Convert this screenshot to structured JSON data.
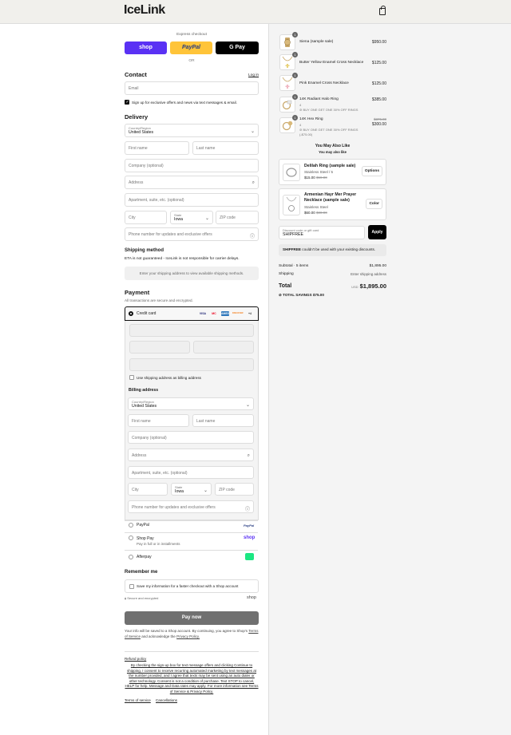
{
  "brand": {
    "logo": "IceLink"
  },
  "express": {
    "title": "Express checkout",
    "shop": "shop",
    "paypal": "PayPal",
    "gpay": "G Pay",
    "or": "OR"
  },
  "contact": {
    "heading": "Contact",
    "login": "Log in",
    "email_placeholder": "Email",
    "signup_text": "Sign up for exclusive offers and news via text messages & email."
  },
  "delivery": {
    "heading": "Delivery",
    "country_label": "Country/Region",
    "country_value": "United States",
    "first_name": "First name",
    "last_name": "Last name",
    "company": "Company (optional)",
    "address": "Address",
    "apartment": "Apartment, suite, etc. (optional)",
    "city": "City",
    "state_label": "State",
    "state_value": "Iowa",
    "zip": "ZIP code",
    "phone": "Phone number for updates and exclusive offers"
  },
  "shipping": {
    "heading": "Shipping method",
    "eta_note": "ETA is not guaranteed - IceLink is not responsible for carrier delays.",
    "placeholder": "Enter your shipping address to view available shipping methods."
  },
  "payment": {
    "heading": "Payment",
    "subtext": "All transactions are secure and encrypted.",
    "credit_card": "Credit card",
    "cards": [
      "VISA",
      "MC",
      "AMEX",
      "DISCOVER",
      "+4"
    ],
    "use_shipping": "Use shipping address as billing address",
    "billing_heading": "Billing address",
    "paypal": "PayPal",
    "paypal_logo": "PayPal",
    "shoppay": "Shop Pay",
    "shoppay_sub": "Pay in full or in installments",
    "shoppay_logo": "shop",
    "afterpay": "Afterpay"
  },
  "remember": {
    "heading": "Remember me",
    "save_text": "Save my information for a faster checkout with a Shop account",
    "secure": "Secure and encrypted",
    "shop_logo": "shop"
  },
  "pay_button": "Pay now",
  "consent": {
    "line1": "Your info will be saved to a Shop account. By continuing, you agree to Shop's",
    "tos": "Terms of Service",
    "and_ack": "and acknowledge the",
    "privacy": "Privacy Policy."
  },
  "footer": {
    "refund": "Refund policy",
    "legal": "By checking the sign-up box for text message offers and clicking Continue to shipping, I consent to receive recurring automated marketing by text messages at the number provided, and I agree that texts may be sent using an auto dialer or other technology. Consent is not a condition of purchase. Text STOP to cancel, HELP for help. Message and Data rates may apply. For more information see Terms of Service & Privacy Policy.",
    "tos": "Terms of service",
    "cancellations": "Cancellations"
  },
  "cart": {
    "items": [
      {
        "qty": "1",
        "name": "Siena (sample sale)",
        "price": "$950.00"
      },
      {
        "qty": "1",
        "name": "Butter Yellow Enamel Cross Necklace",
        "price": "$125.00"
      },
      {
        "qty": "1",
        "name": "Pink Enamel Cross Necklace",
        "price": "$125.00"
      },
      {
        "qty": "1",
        "name": "14K Radiant Halo Ring",
        "price": "$385.00",
        "variant": "4",
        "promo": "BUY ONE GET ONE 30% OFF RINGS"
      },
      {
        "qty": "1",
        "name": "14K Hex Ring",
        "price": "$300.00",
        "orig": "$375.00",
        "variant": "4",
        "promo": "BUY ONE GET ONE 30% OFF RINGS",
        "promo_amt": "(-$75.00)"
      }
    ],
    "may_like_title": "You May Also Like",
    "may_like_sub": "You may also like",
    "recs": [
      {
        "name": "Delilah Ring (sample sale)",
        "variant": "Stainless Steel / 5",
        "price": "$15.00",
        "orig": "$59.00",
        "button": "Options"
      },
      {
        "name": "Armenian Hayr Mer Prayer Necklace (sample sale)",
        "variant": "Stainless Steel",
        "price": "$60.00",
        "orig": "$80.00",
        "button": "Color"
      }
    ],
    "discount_label": "Discount code or gift card",
    "discount_value": "SHIPFREE",
    "apply": "Apply",
    "discount_msg_code": "SHIPFREE",
    "discount_msg": "couldn't be used with your existing discounts.",
    "subtotal_label": "Subtotal · 5 items",
    "subtotal_value": "$1,895.00",
    "shipping_label": "Shipping",
    "shipping_value": "Enter shipping address",
    "total_label": "Total",
    "currency": "USD",
    "total_value": "$1,895.00",
    "savings_label": "TOTAL SAVINGS",
    "savings_value": "$75.00"
  },
  "colors": {
    "shop": "#5a31f4",
    "paypal": "#ffc439",
    "pay_button": "#707070",
    "afterpay": "#1ce783"
  }
}
